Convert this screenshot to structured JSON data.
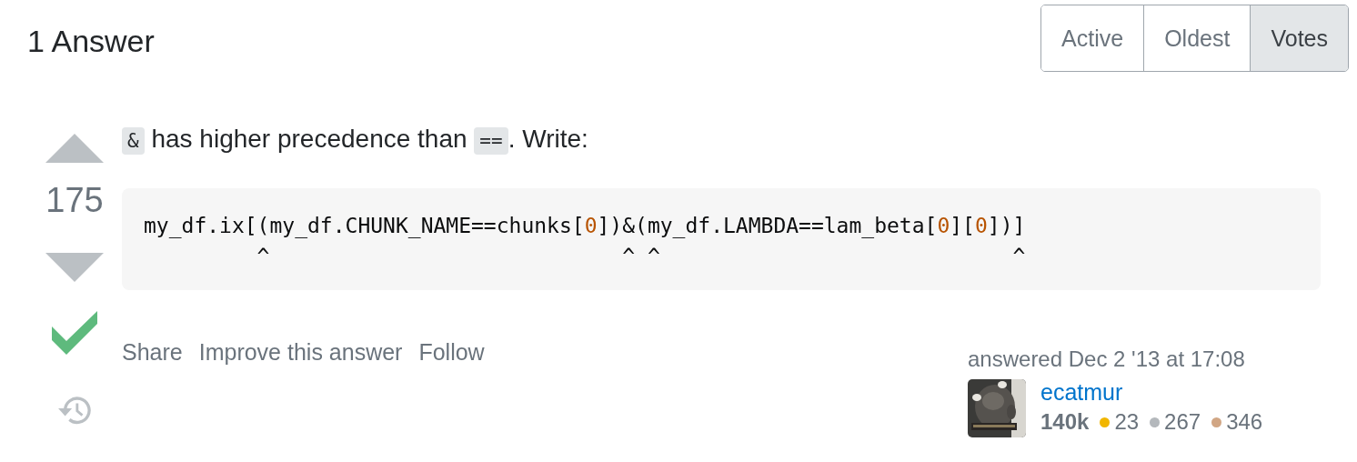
{
  "heading": "1 Answer",
  "sort_tabs": [
    {
      "label": "Active",
      "selected": false
    },
    {
      "label": "Oldest",
      "selected": false
    },
    {
      "label": "Votes",
      "selected": true
    }
  ],
  "answer": {
    "score": "175",
    "accepted": true,
    "body": [
      {
        "kind": "code",
        "text": "&"
      },
      {
        "kind": "text",
        "text": " has higher precedence than "
      },
      {
        "kind": "code",
        "text": "=="
      },
      {
        "kind": "text",
        "text": ". Write:"
      }
    ],
    "code_lines": [
      [
        {
          "kind": "plain",
          "text": "my_df.ix[(my_df.CHUNK_NAME==chunks["
        },
        {
          "kind": "number",
          "text": "0"
        },
        {
          "kind": "plain",
          "text": "])&(my_df.LAMBDA==lam_beta["
        },
        {
          "kind": "number",
          "text": "0"
        },
        {
          "kind": "plain",
          "text": "]["
        },
        {
          "kind": "number",
          "text": "0"
        },
        {
          "kind": "plain",
          "text": "])]"
        }
      ],
      [
        {
          "kind": "plain",
          "text": "         ^                            ^ ^                            ^"
        }
      ]
    ],
    "actions": [
      "Share",
      "Improve this answer",
      "Follow"
    ],
    "signature": {
      "action_time": "answered Dec 2 '13 at 17:08",
      "user_name": "ecatmur",
      "reputation": "140k",
      "badges": [
        {
          "count": "23",
          "color": "#f1b600"
        },
        {
          "count": "267",
          "color": "#b4b8bc"
        },
        {
          "count": "346",
          "color": "#d1a684"
        }
      ]
    }
  }
}
